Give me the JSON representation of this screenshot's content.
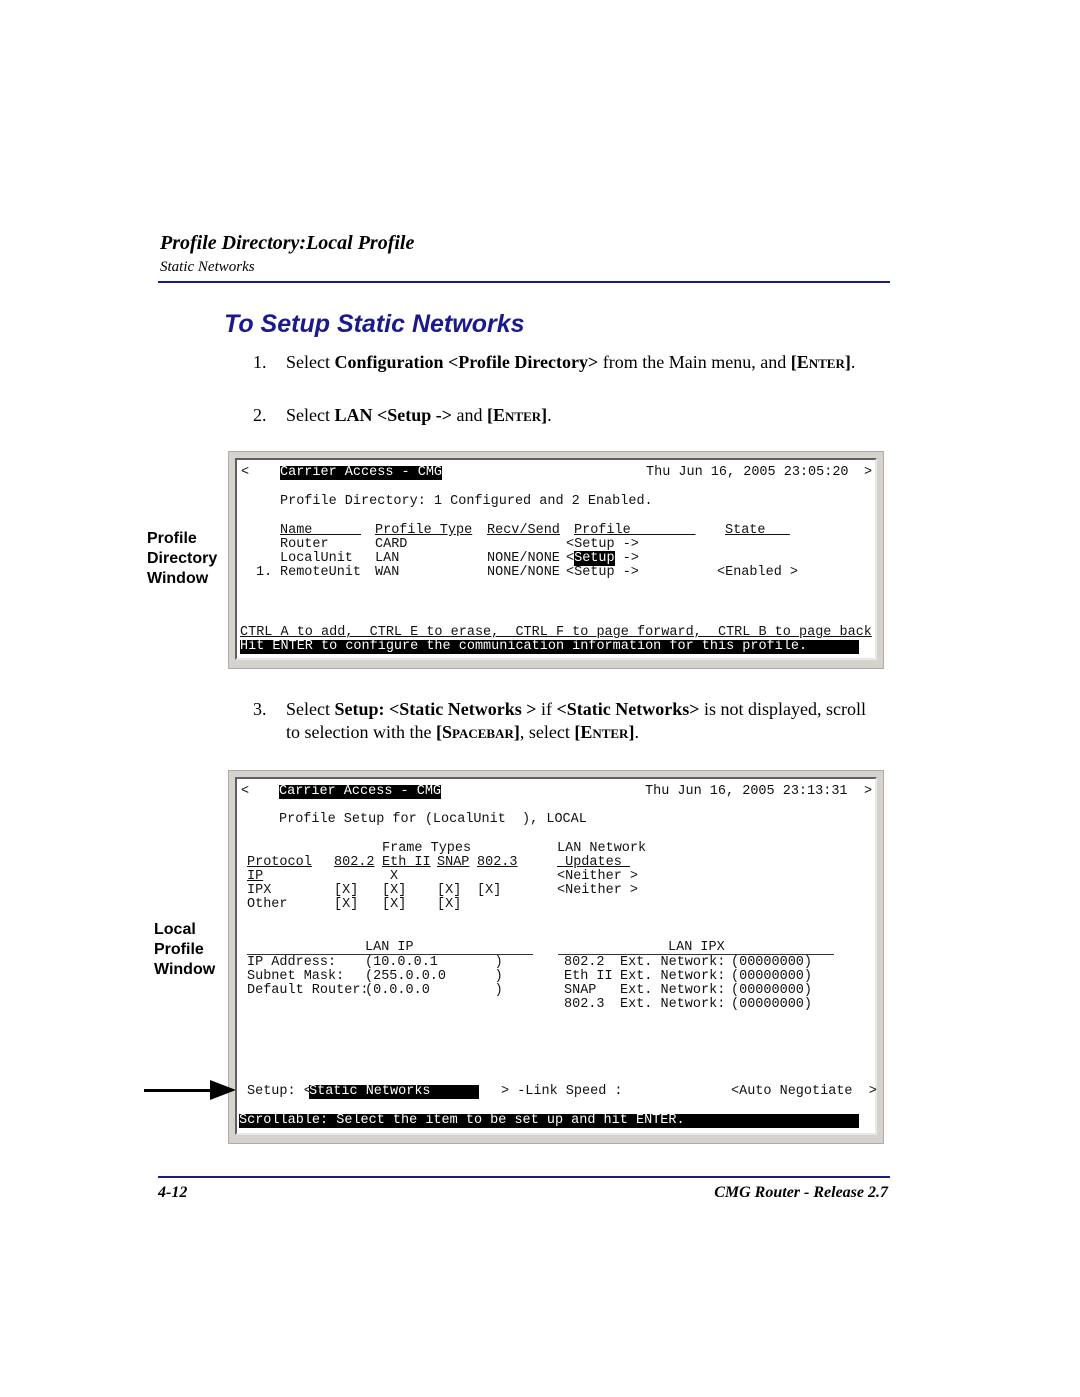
{
  "header": {
    "title": "Profile Directory:Local Profile",
    "subtitle": "Static Networks",
    "rule_color": "#1a1a8c"
  },
  "section_title": "To Setup Static Networks",
  "steps": [
    {
      "num": "1.",
      "parts": [
        "Select ",
        "Configuration <Profile Directory>",
        " from the Main menu, and ",
        "[Enter]",
        "."
      ]
    },
    {
      "num": "2.",
      "parts": [
        "Select ",
        "LAN <Setup ->",
        " and ",
        "[Enter]",
        "."
      ]
    },
    {
      "num": "3.",
      "parts": [
        "Select ",
        "Setup: <Static Networks >",
        " if ",
        "<Static Networks>",
        " is not displayed, scroll to selection with the ",
        "[Spacebar]",
        ", select ",
        "[Enter]",
        "."
      ]
    }
  ],
  "screen1": {
    "side_label": [
      "Profile",
      "Directory",
      "Window"
    ],
    "left_arrow": "<",
    "right_arrow": ">",
    "app_title": "Carrier Access - CMG",
    "datetime": "Thu Jun 16, 2005 23:05:20",
    "summary": "Profile Directory: 1 Configured and 2 Enabled.",
    "columns": [
      "Name      ",
      "Profile Type",
      "Recv/Send",
      "Profile        ",
      "State   "
    ],
    "rows": [
      {
        "index": "",
        "name": "Router",
        "type": "CARD",
        "recv_send": "",
        "profile": "<Setup ->",
        "state": ""
      },
      {
        "index": "",
        "name": "LocalUnit",
        "type": "LAN",
        "recv_send": "NONE/NONE",
        "profile_pre": "<",
        "profile_sel": "Setup",
        "profile_post": " ->",
        "state": ""
      },
      {
        "index": "1.",
        "name": "RemoteUnit",
        "type": "WAN",
        "recv_send": "NONE/NONE",
        "profile": "<Setup ->",
        "state": "<Enabled >"
      }
    ],
    "help": "CTRL A to add,  CTRL E to erase,  CTRL F to page forward,  CTRL B to page back",
    "status": "Hit ENTER to configure the communication information for this profile."
  },
  "screen2": {
    "side_label": [
      "Local",
      "Profile",
      "Window"
    ],
    "left_arrow": "<",
    "right_arrow": ">",
    "app_title": "Carrier Access - CMG",
    "datetime": "Thu Jun 16, 2005 23:13:31",
    "profile_line": "Profile Setup for (LocalUnit  ), LOCAL",
    "frame_types_label": "Frame Types",
    "lan_network_label": "LAN Network",
    "protocol_header": "Protocol",
    "frame_cols": [
      "802.2",
      "Eth II",
      "SNAP",
      "802.3"
    ],
    "updates_header": " Updates ",
    "protocols": [
      {
        "name": "IP",
        "c8022": "",
        "ethii": "X",
        "snap": "",
        "c8023": "",
        "updates": "<Neither >"
      },
      {
        "name": "IPX",
        "c8022": "[X]",
        "ethii": "[X]",
        "snap": "[X]",
        "c8023": "[X]",
        "updates": "<Neither >"
      },
      {
        "name": "Other",
        "c8022": "[X]",
        "ethii": "[X]",
        "snap": "[X]",
        "c8023": "",
        "updates": ""
      }
    ],
    "lan_ip_title": "LAN IP",
    "lan_ip": [
      {
        "label": "IP Address:",
        "value": "(10.0.0.1       )"
      },
      {
        "label": "Subnet Mask:",
        "value": "(255.0.0.0      )"
      },
      {
        "label": "Default Router:",
        "value": "(0.0.0.0        )"
      }
    ],
    "lan_ipx_title": "LAN IPX",
    "lan_ipx": [
      {
        "frame": "802.2 ",
        "label": "Ext. Network:",
        "value": "(00000000)"
      },
      {
        "frame": "Eth II",
        "label": "Ext. Network:",
        "value": "(00000000)"
      },
      {
        "frame": "SNAP  ",
        "label": "Ext. Network:",
        "value": "(00000000)"
      },
      {
        "frame": "802.3 ",
        "label": "Ext. Network:",
        "value": "(00000000)"
      }
    ],
    "setup_label": "Setup: <",
    "setup_value": "Static Networks      ",
    "setup_close": "> -Link Speed :",
    "link_speed": "<Auto Negotiate  >",
    "status": "Scrollable: Select the item to be set up and hit ENTER."
  },
  "footer": {
    "page": "4-12",
    "doc": "CMG Router - Release 2.7"
  }
}
